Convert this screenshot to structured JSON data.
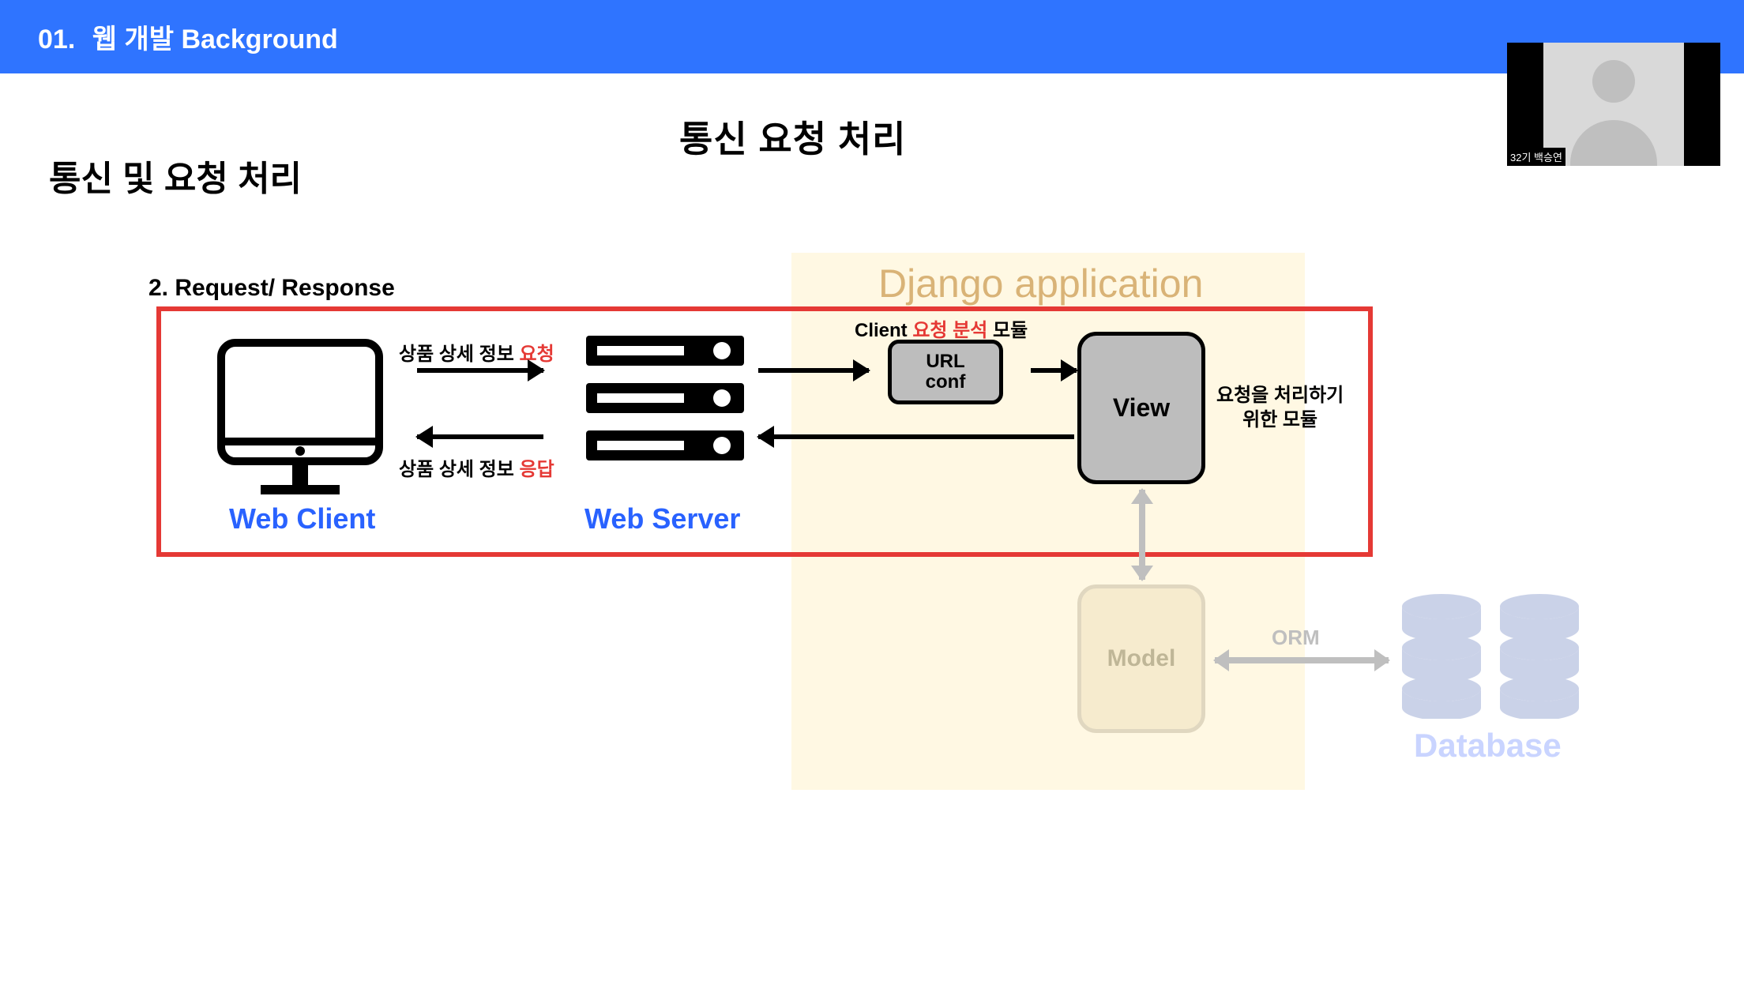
{
  "header": {
    "number": "01.",
    "title": "웹 개발 Background"
  },
  "titles": {
    "main": "통신  요청 처리",
    "sub": "통신 및 요청 처리",
    "section": "2. Request/ Response"
  },
  "diagram": {
    "client_label": "Web Client",
    "server_label": "Web Server",
    "request_text_prefix": "상품 상세 정보 ",
    "request_text_accent": "요청",
    "response_text_prefix": "상품 상세 정보 ",
    "response_text_accent": "응답",
    "client_analysis_prefix": "Client ",
    "client_analysis_accent": "요청 분석",
    "client_analysis_suffix": " 모듈",
    "url_conf_line1": "URL",
    "url_conf_line2": "conf",
    "view_label": "View",
    "view_desc_line1": "요청을 처리하기",
    "view_desc_line2": "위한 모듈",
    "django_label": "Django application",
    "model_label": "Model",
    "orm_label": "ORM",
    "database_label": "Database"
  },
  "webcam": {
    "tag": "32기 백승연"
  }
}
